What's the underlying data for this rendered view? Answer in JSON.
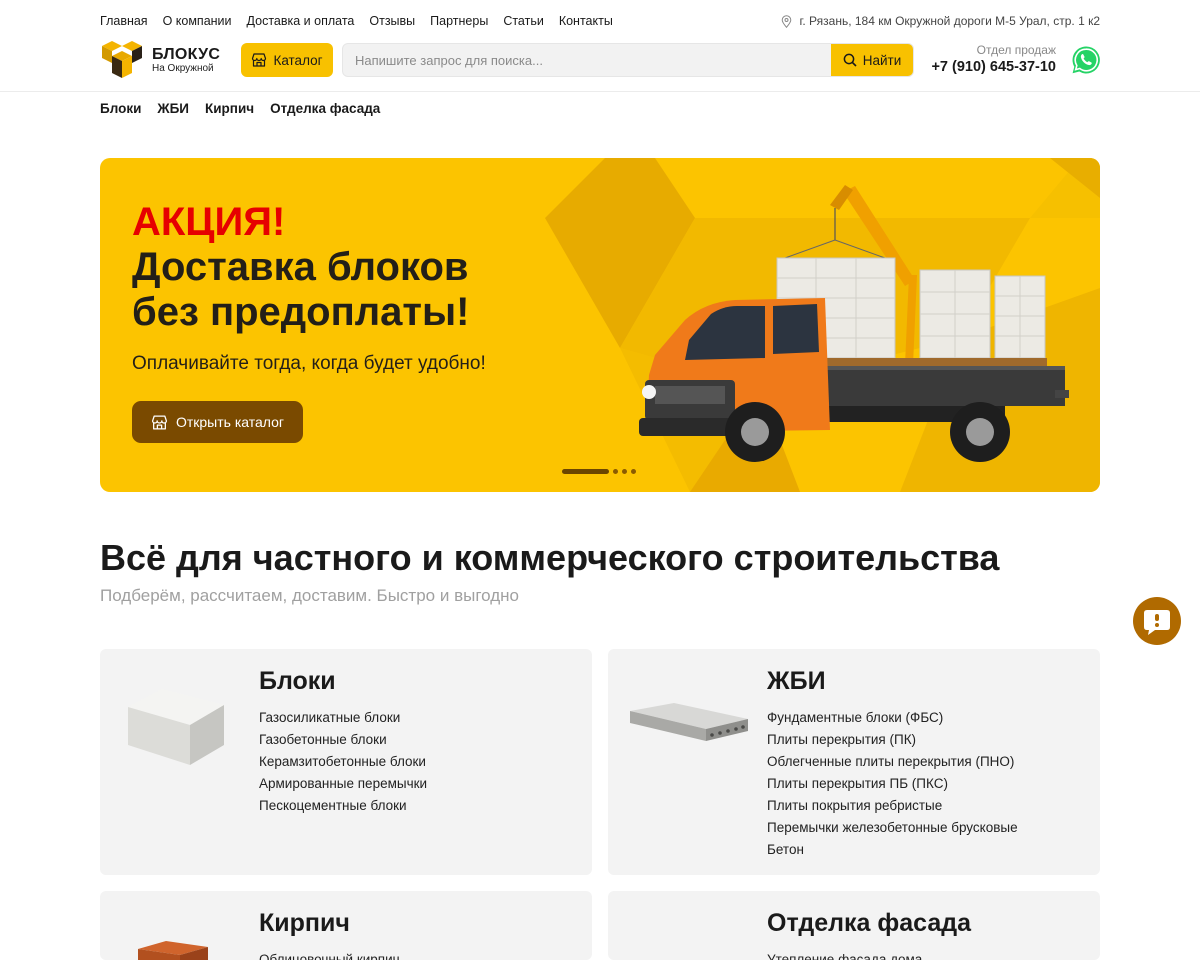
{
  "topnav": [
    "Главная",
    "О компании",
    "Доставка и оплата",
    "Отзывы",
    "Партнеры",
    "Статьи",
    "Контакты"
  ],
  "address": "г. Рязань, 184 км Окружной дороги М-5 Урал, стр. 1 к2",
  "logo": {
    "title": "БЛОКУС",
    "subtitle": "На Окружной"
  },
  "catalog_label": "Каталог",
  "search": {
    "placeholder": "Напишите запрос для поиска...",
    "button": "Найти"
  },
  "contact": {
    "label": "Отдел продаж",
    "phone": "+7 (910) 645-37-10"
  },
  "subnav": [
    "Блоки",
    "ЖБИ",
    "Кирпич",
    "Отделка фасада"
  ],
  "banner": {
    "line1": "АКЦИЯ!",
    "line2": "Доставка блоков",
    "line3": "без предоплаты!",
    "text": "Оплачивайте тогда, когда будет удобно!",
    "button": "Открыть каталог",
    "slides": 4,
    "active_slide": 1
  },
  "section": {
    "title": "Всё для частного и коммерческого строительства",
    "subtitle": "Подберём, рассчитаем, доставим. Быстро и выгодно"
  },
  "categories": [
    {
      "title": "Блоки",
      "items": [
        "Газосиликатные блоки",
        "Газобетонные блоки",
        "Керамзитобетонные блоки",
        "Армированные перемычки",
        "Пескоцементные блоки"
      ]
    },
    {
      "title": "ЖБИ",
      "items": [
        "Фундаментные блоки (ФБС)",
        "Плиты перекрытия (ПК)",
        "Облегченные плиты перекрытия (ПНО)",
        "Плиты перекрытия ПБ (ПКС)",
        "Плиты покрытия ребристые",
        "Перемычки железобетонные брусковые",
        "Бетон"
      ]
    },
    {
      "title": "Кирпич",
      "items": [
        "Облицовочный кирпич"
      ]
    },
    {
      "title": "Отделка фасада",
      "items": [
        "Утепление фасада дома"
      ]
    }
  ],
  "colors": {
    "accent": "#fcc400",
    "button_dark": "#7a4a00",
    "promo_red": "#e60000"
  }
}
